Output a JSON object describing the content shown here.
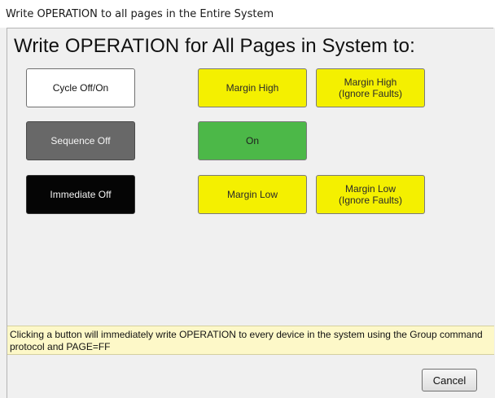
{
  "window": {
    "title": "Write OPERATION to all pages in the Entire System"
  },
  "dialog": {
    "heading": "Write OPERATION for All Pages in System to:",
    "buttons": {
      "cycle_off_on": "Cycle Off/On",
      "sequence_off": "Sequence Off",
      "immediate_off": "Immediate Off",
      "margin_high": "Margin High",
      "on": "On",
      "margin_low": "Margin Low",
      "margin_high_ignore_faults": "Margin High\n(Ignore Faults)",
      "margin_low_ignore_faults": "Margin Low\n(Ignore Faults)"
    },
    "info_text": "Clicking a button will immediately write OPERATION to every device in the system using the Group command protocol and PAGE=FF",
    "cancel_label": "Cancel"
  },
  "colors": {
    "white_button": "#ffffff",
    "gray_button": "#686868",
    "black_button": "#050505",
    "yellow_button": "#f4f000",
    "green_button": "#4cb848",
    "info_background": "#fdf8c8"
  }
}
